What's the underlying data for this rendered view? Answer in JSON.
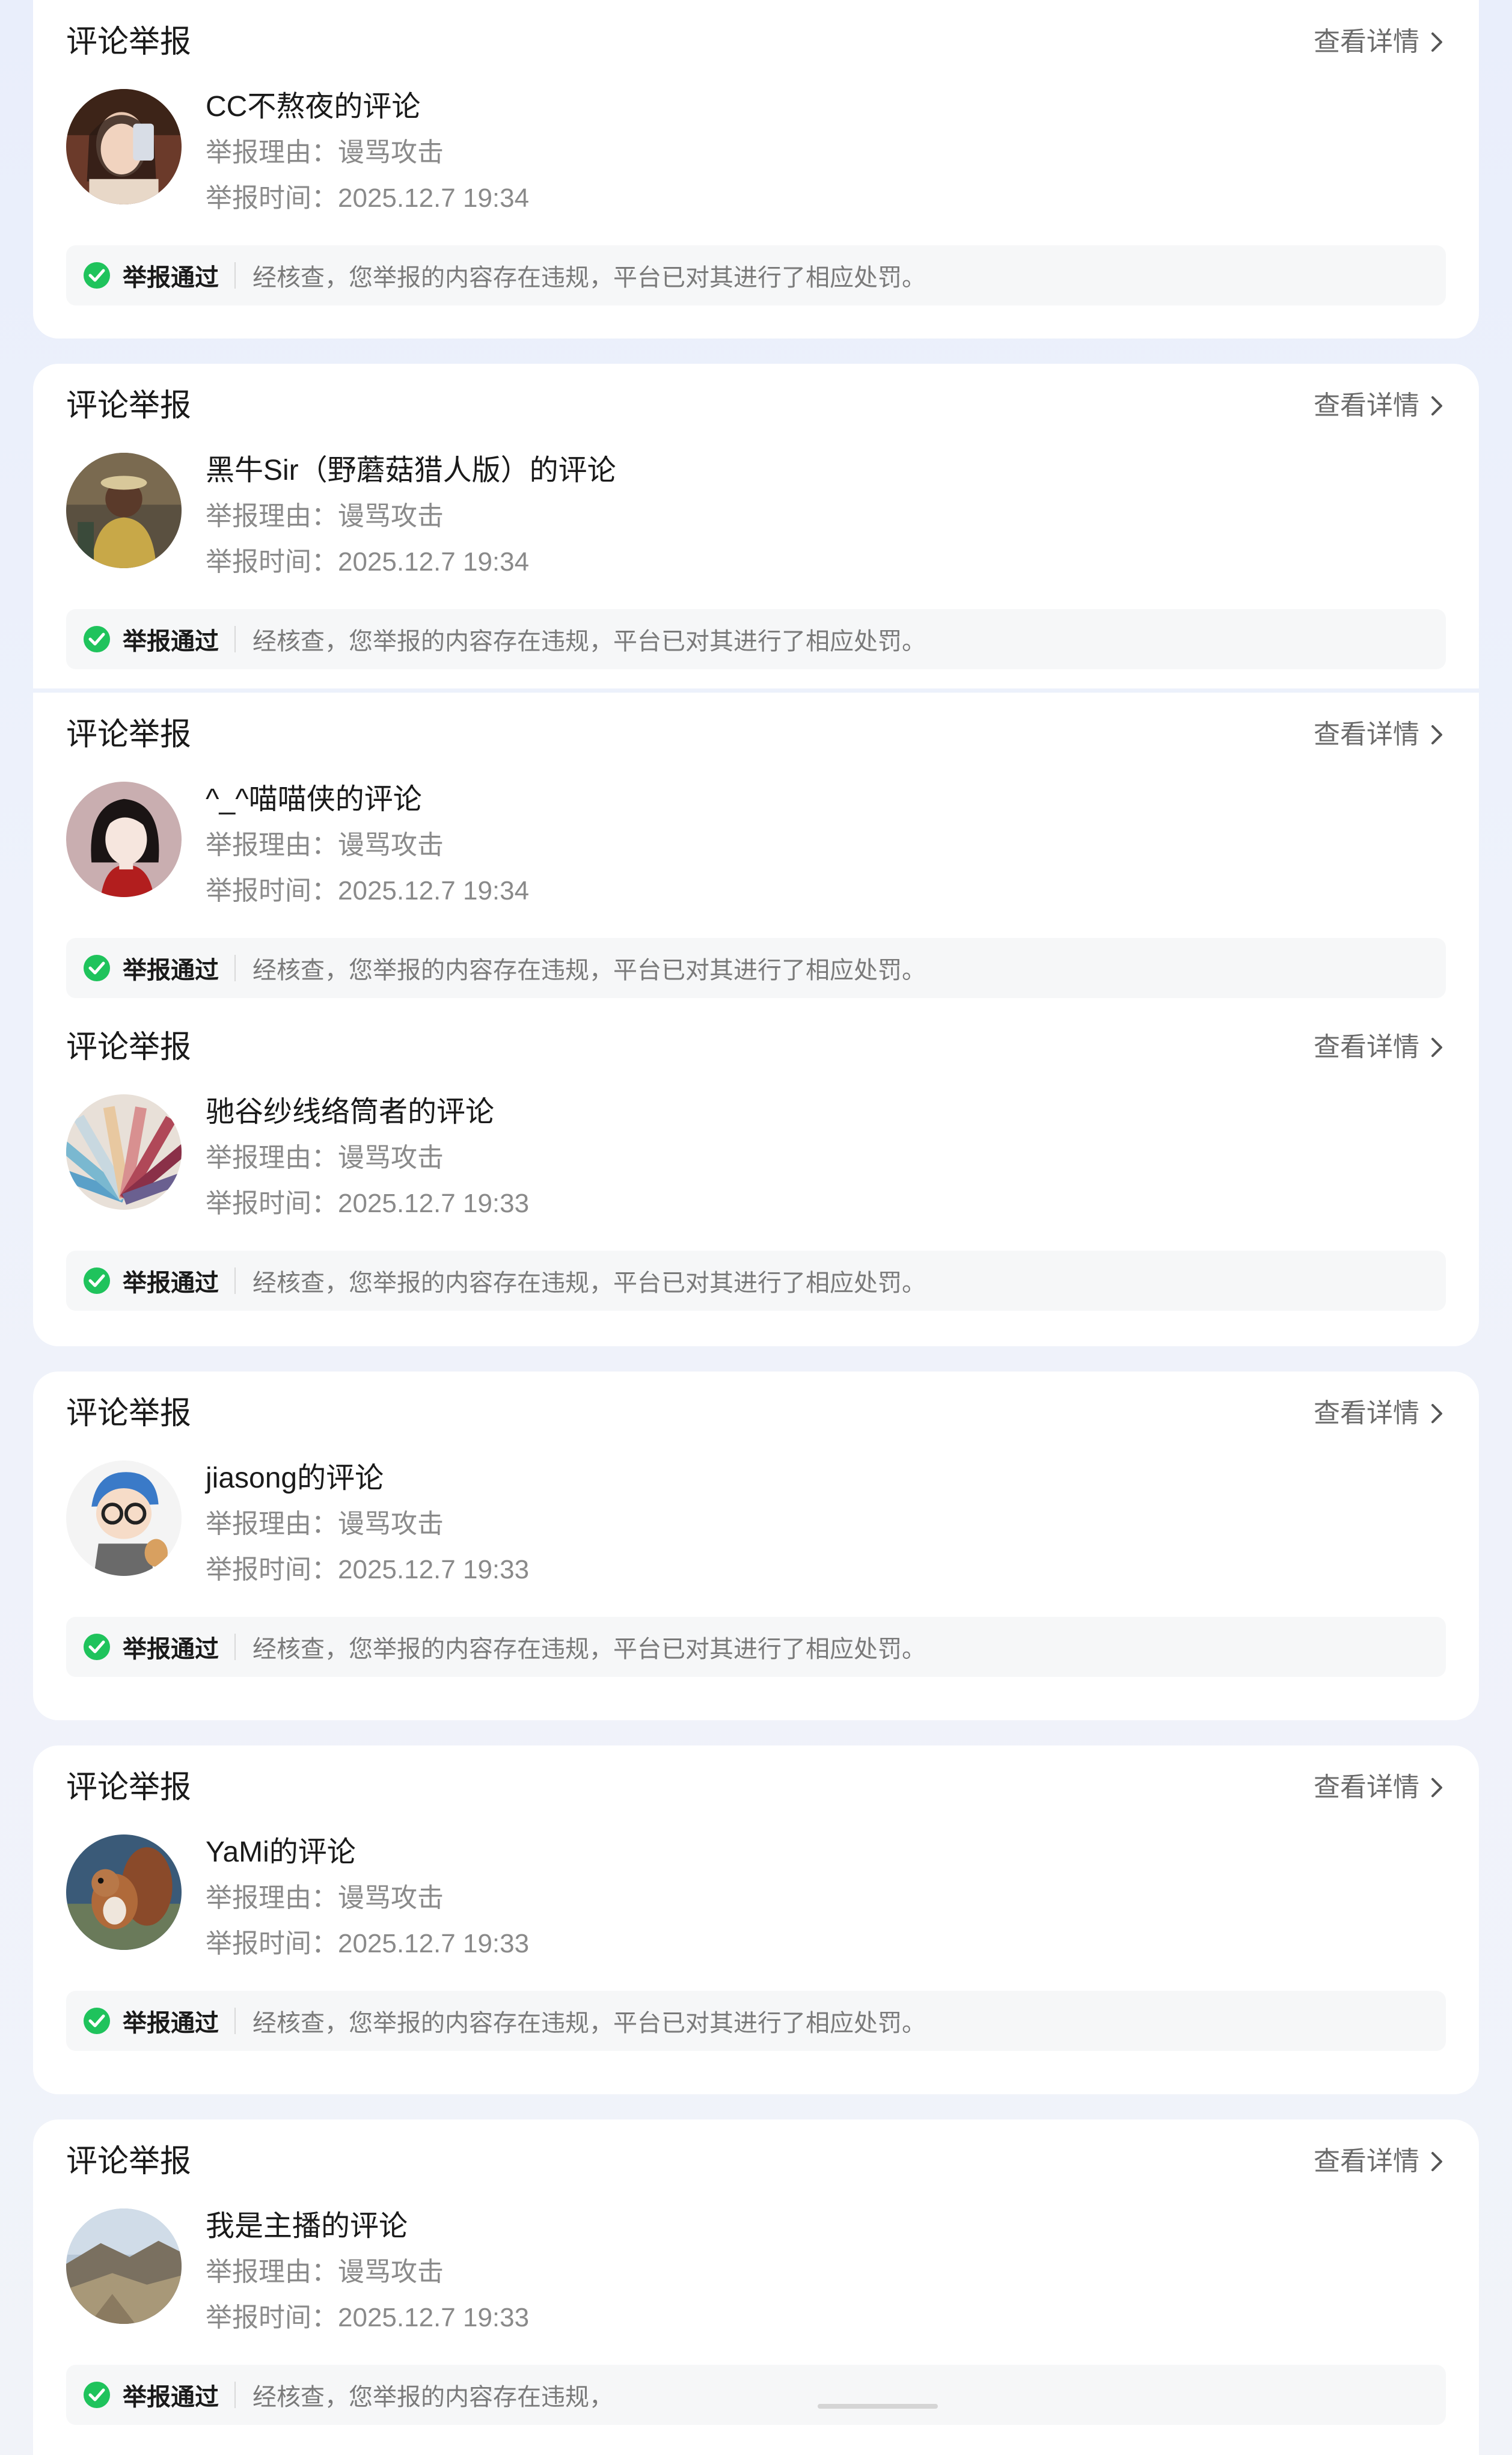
{
  "common": {
    "card_title": "评论举报",
    "detail_link": "查看详情",
    "reason_label": "举报理由：",
    "time_label": "举报时间：",
    "status_label": "举报通过",
    "status_color": "#1fc35c"
  },
  "reports": [
    {
      "name": "CC不熬夜的评论",
      "reason": "谩骂攻击",
      "time": "2025.12.7 19:34",
      "result": "经核查，您举报的内容存在违规，平台已对其进行了相应处罚。"
    },
    {
      "name": "黑牛Sir（野蘑菇猎人版）的评论",
      "reason": "谩骂攻击",
      "time": "2025.12.7 19:34",
      "result": "经核查，您举报的内容存在违规，平台已对其进行了相应处罚。"
    },
    {
      "name": "^_^喵喵侠的评论",
      "reason": "谩骂攻击",
      "time": "2025.12.7 19:34",
      "result": "经核查，您举报的内容存在违规，平台已对其进行了相应处罚。"
    },
    {
      "name": "驰谷纱线络筒者的评论",
      "reason": "谩骂攻击",
      "time": "2025.12.7 19:33",
      "result": "经核查，您举报的内容存在违规，平台已对其进行了相应处罚。"
    },
    {
      "name": "jiasong的评论",
      "reason": "谩骂攻击",
      "time": "2025.12.7 19:33",
      "result": "经核查，您举报的内容存在违规，平台已对其进行了相应处罚。"
    },
    {
      "name": "YaMi的评论",
      "reason": "谩骂攻击",
      "time": "2025.12.7 19:33",
      "result": "经核查，您举报的内容存在违规，平台已对其进行了相应处罚。"
    },
    {
      "name": "我是主播的评论",
      "reason": "谩骂攻击",
      "time": "2025.12.7 19:33",
      "result": "经核查，您举报的内容存在违规，"
    }
  ]
}
